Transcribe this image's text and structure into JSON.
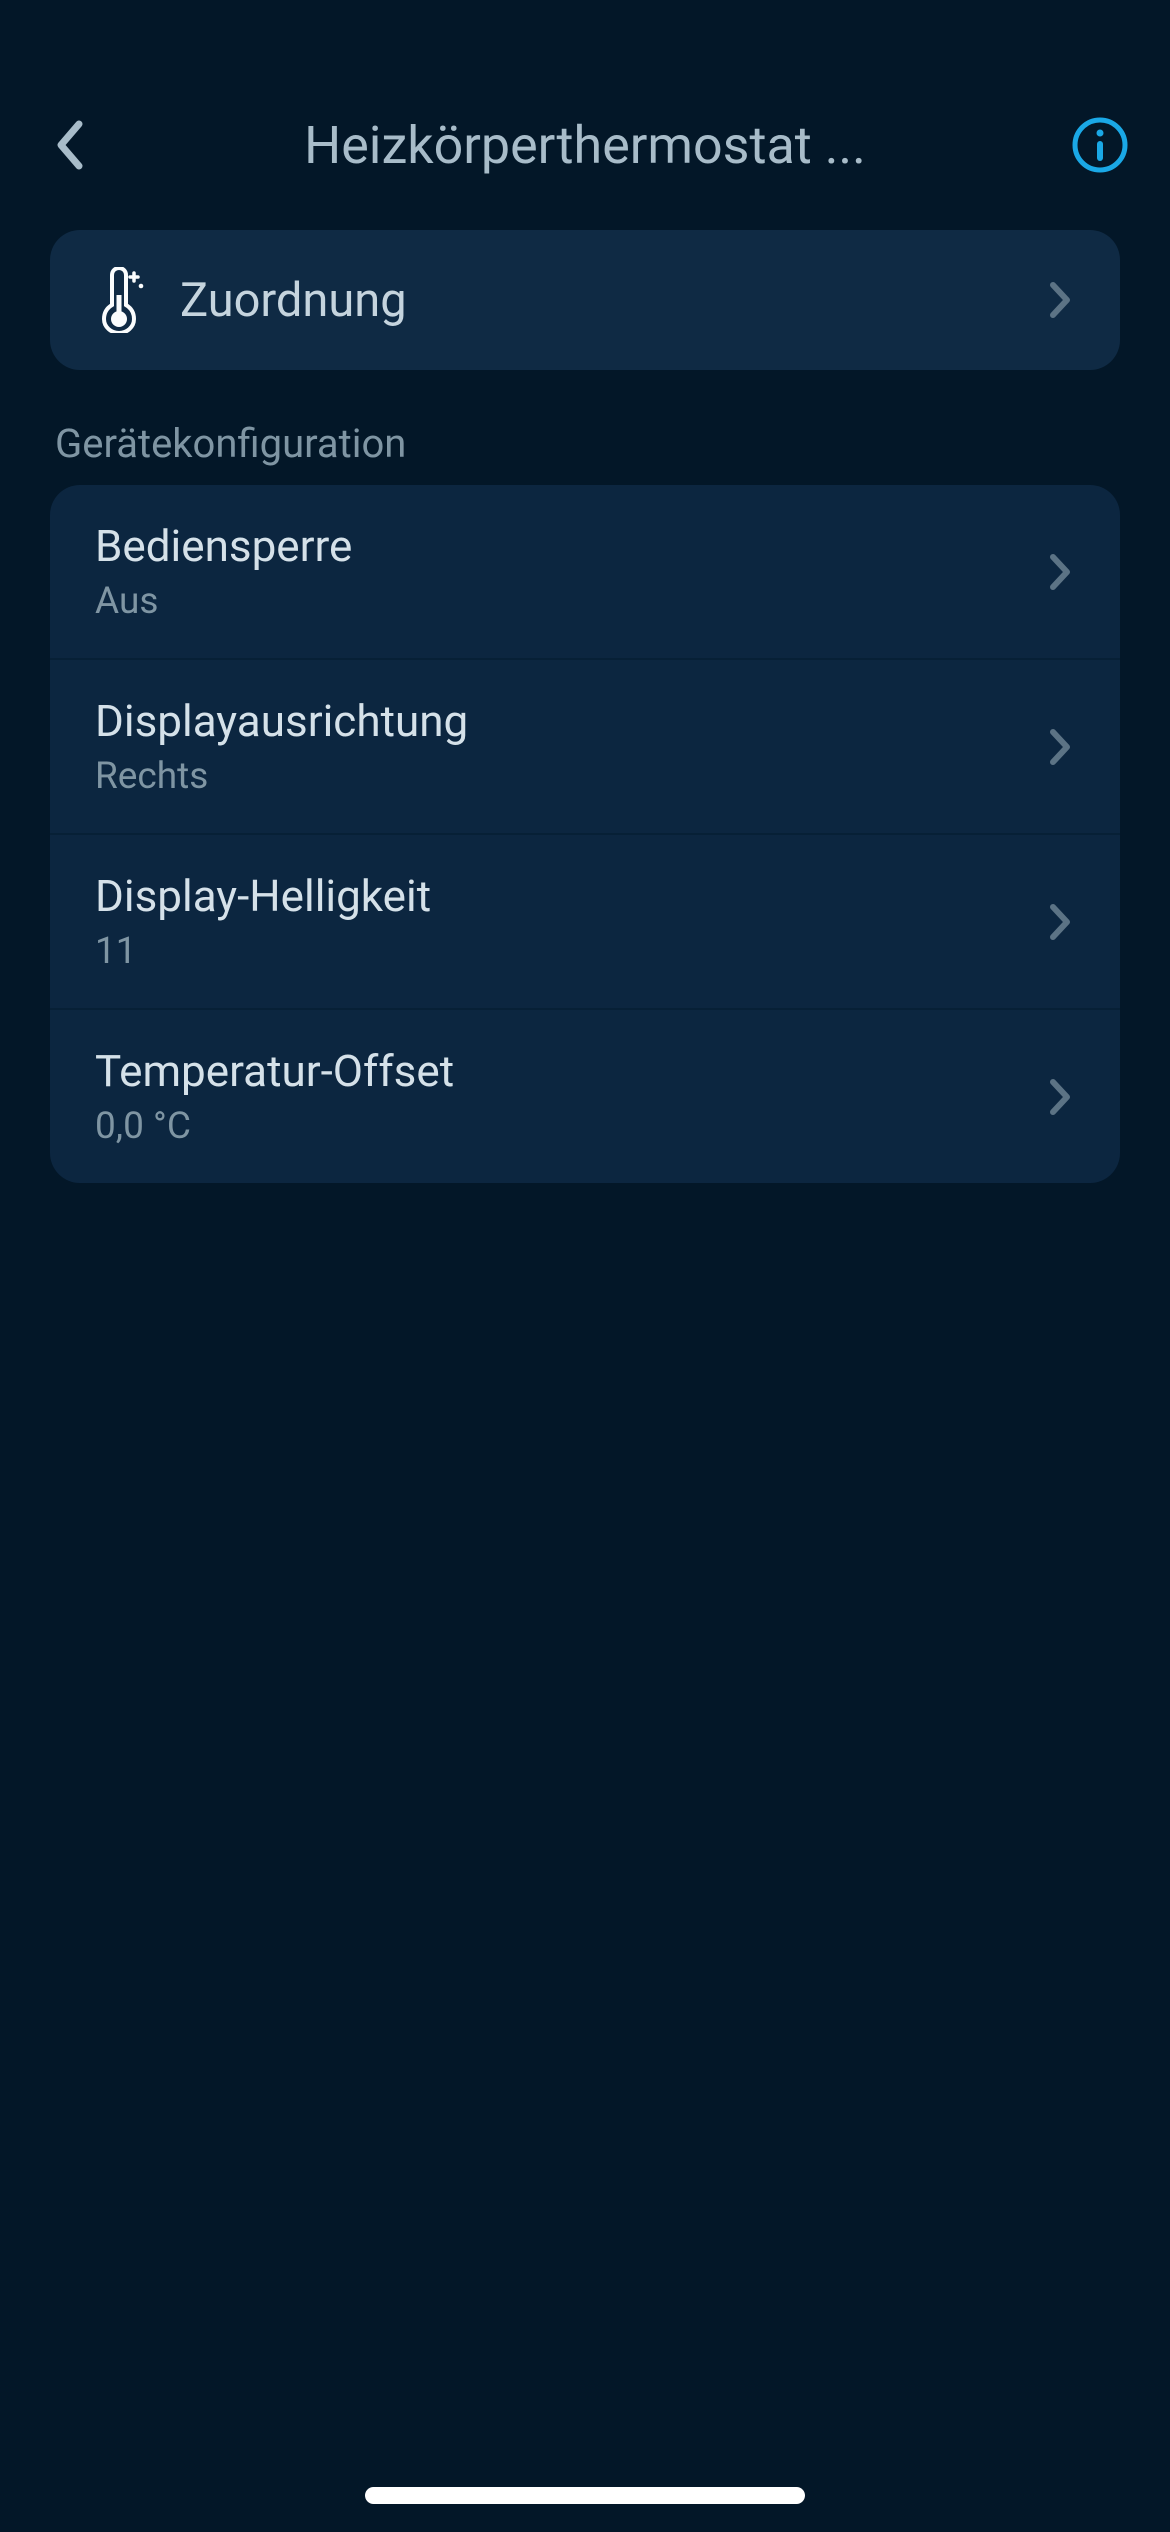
{
  "header": {
    "title": "Heizkörperthermostat ..."
  },
  "top_card": {
    "label": "Zuordnung"
  },
  "section": {
    "header": "Gerätekonfiguration",
    "items": [
      {
        "label": "Bediensperre",
        "value": "Aus"
      },
      {
        "label": "Displayausrichtung",
        "value": "Rechts"
      },
      {
        "label": "Display-Helligkeit",
        "value": "11"
      },
      {
        "label": "Temperatur-Offset",
        "value": "0,0 °C"
      }
    ]
  }
}
